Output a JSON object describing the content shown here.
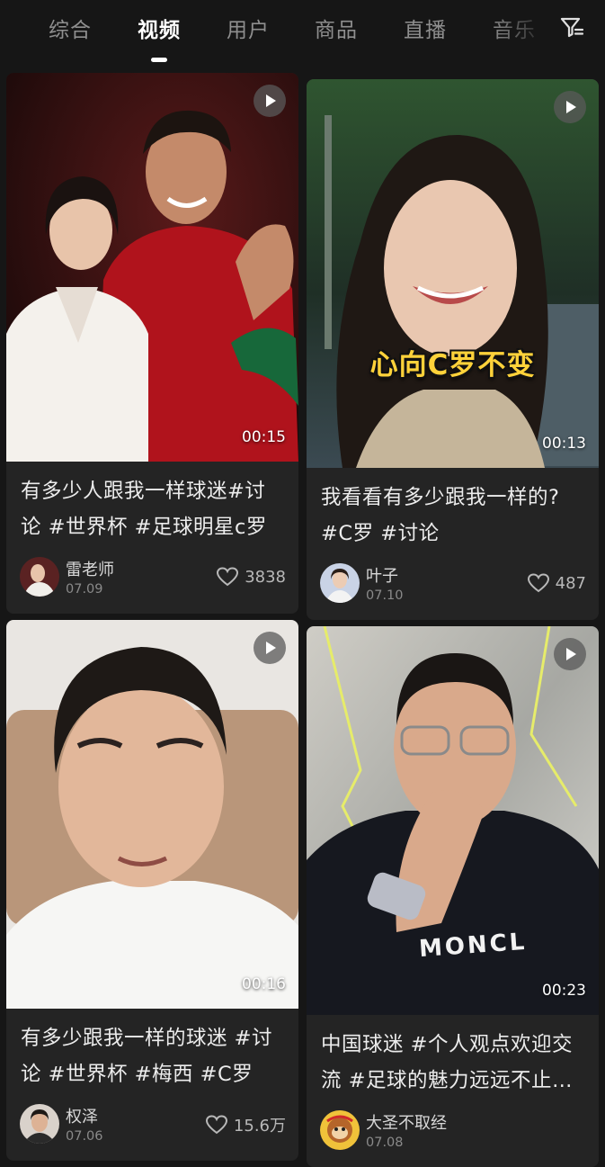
{
  "tabs": [
    {
      "label": "综合",
      "active": false
    },
    {
      "label": "视频",
      "active": true
    },
    {
      "label": "用户",
      "active": false
    },
    {
      "label": "商品",
      "active": false
    },
    {
      "label": "直播",
      "active": false
    },
    {
      "label": "音乐",
      "active": false
    }
  ],
  "filter_icon": "filter-icon",
  "cards": [
    {
      "duration": "00:15",
      "title": "有多少人跟我一样球迷#讨论 #世界杯 #足球明星c罗",
      "author": "雷老师",
      "date": "07.09",
      "likes": "3838"
    },
    {
      "duration": "00:13",
      "overlay_text": "心向C罗不变",
      "title": "我看看有多少跟我一样的? #C罗 #讨论",
      "author": "叶子",
      "date": "07.10",
      "likes": "487"
    },
    {
      "duration": "00:16",
      "title": "有多少跟我一样的球迷 #讨论 #世界杯 #梅西 #C罗",
      "author": "权泽",
      "date": "07.06",
      "likes": "15.6万"
    },
    {
      "duration": "00:23",
      "shirt_text": "MONCL",
      "title": "中国球迷 #个人观点欢迎交流 #足球的魅力远远不止于此",
      "author": "大圣不取经",
      "date": "07.08",
      "likes": ""
    }
  ],
  "colors": {
    "background": "#161616",
    "card": "#242424",
    "overlay_text": "#ffd23a"
  }
}
